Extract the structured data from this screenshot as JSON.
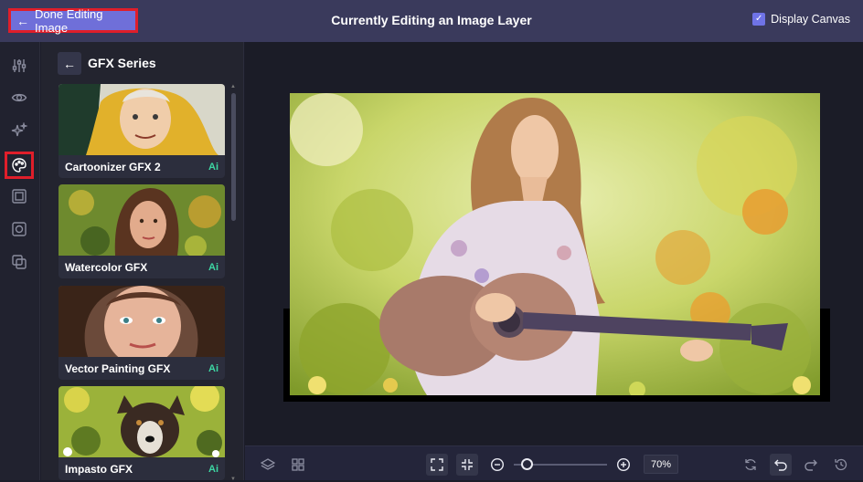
{
  "topbar": {
    "done_label": "Done Editing Image",
    "title": "Currently Editing an Image Layer",
    "display_canvas_label": "Display Canvas",
    "display_canvas_checked": true
  },
  "rail": {
    "icons": [
      "sliders-icon",
      "eye-icon",
      "sparkles-icon",
      "palette-icon",
      "frame-icon",
      "frame-stack-icon",
      "layers-copy-icon"
    ],
    "selected": "palette-icon"
  },
  "panel": {
    "title": "GFX Series",
    "items": [
      {
        "label": "Cartoonizer GFX 2",
        "badge": "Ai"
      },
      {
        "label": "Watercolor GFX",
        "badge": "Ai"
      },
      {
        "label": "Vector Painting GFX",
        "badge": "Ai"
      },
      {
        "label": "Impasto GFX",
        "badge": "Ai"
      }
    ]
  },
  "toolbar": {
    "zoom_value": "70%",
    "zoom_fraction": 0.14
  },
  "colors": {
    "topbar": "#3a3a5c",
    "accent": "#6f6fd9",
    "highlight_border": "#e01e2a",
    "ai_badge": "#3dd6a3"
  }
}
